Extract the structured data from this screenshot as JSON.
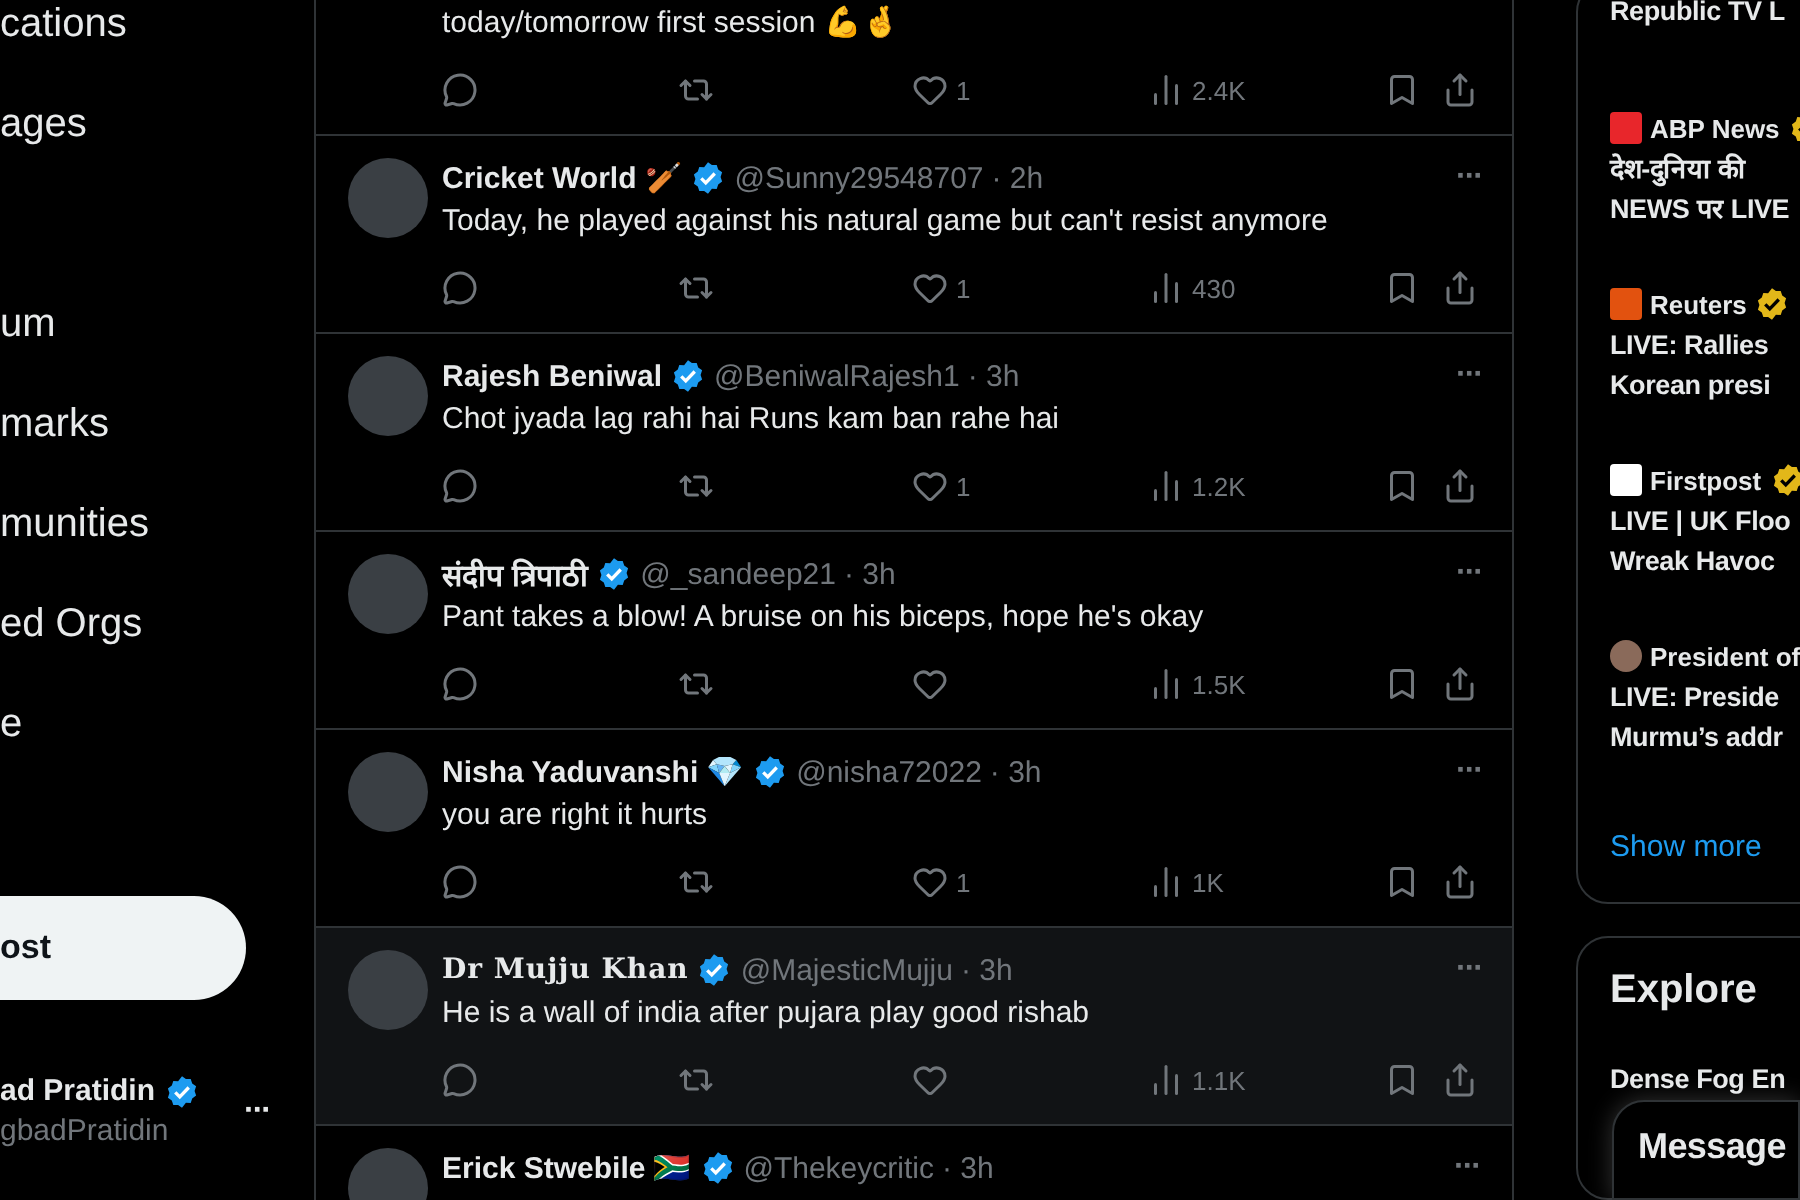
{
  "sidebar": {
    "nav_items": [
      {
        "label": "cations"
      },
      {
        "label": "ages"
      },
      {
        "kind": "hidden"
      },
      {
        "label": "um"
      },
      {
        "label": "marks"
      },
      {
        "label": "munities"
      },
      {
        "label": "ed Orgs"
      },
      {
        "label": "e"
      }
    ],
    "post_button": "ost",
    "account": {
      "name": "ad Pratidin",
      "handle": "gbadPratidin",
      "verified": true,
      "more": "···"
    }
  },
  "feed": {
    "posts": [
      {
        "kind": "partial",
        "text": "today/tomorrow first session 💪🤞",
        "likes": "1",
        "views": "2.4K",
        "highlighted": false
      },
      {
        "kind": "full",
        "name": "Cricket World",
        "serif_name": false,
        "emoji": "🏏",
        "verified": true,
        "handle": "@Sunny29548707",
        "time": "· 2h",
        "text": "Today, he played against his natural game but can't resist anymore",
        "likes": "1",
        "views": "430",
        "highlighted": false,
        "more": "···"
      },
      {
        "kind": "full",
        "name": "Rajesh Beniwal",
        "serif_name": false,
        "verified": true,
        "handle": "@BeniwalRajesh1",
        "time": "· 3h",
        "text": "Chot jyada lag rahi hai Runs kam ban rahe hai",
        "likes": "1",
        "views": "1.2K",
        "highlighted": false,
        "more": "···"
      },
      {
        "kind": "full",
        "name": "संदीप त्रिपाठी",
        "serif_name": false,
        "verified": true,
        "handle": "@_sandeep21",
        "time": "· 3h",
        "text": "Pant takes a blow! A bruise on his biceps, hope he's okay",
        "views": "1.5K",
        "highlighted": false,
        "more": "···"
      },
      {
        "kind": "full",
        "name": "Nisha Yaduvanshi",
        "serif_name": false,
        "emoji": "💎",
        "verified": true,
        "handle": "@nisha72022",
        "time": "· 3h",
        "text": "you are right it hurts",
        "likes": "1",
        "views": "1K",
        "highlighted": false,
        "more": "···"
      },
      {
        "kind": "full",
        "name": "Dr Mujju Khan",
        "serif_name": true,
        "verified": true,
        "handle": "@MajesticMujju",
        "time": "· 3h",
        "text": "He is a wall of india after pujara play good rishab",
        "views": "1.1K",
        "highlighted": true,
        "more": "···"
      },
      {
        "kind": "full",
        "name": "Erick Stwebile",
        "serif_name": false,
        "emoji": "🇿🇦",
        "verified": true,
        "handle": "@Thekeycritic",
        "time": "· 3h",
        "highlighted": false,
        "more": "···"
      }
    ]
  },
  "news": {
    "items": [
      {
        "kind": "partial",
        "headline": [
          "Republic TV L"
        ]
      },
      {
        "kind": "full",
        "source": "ABP News",
        "color": "#e8262b",
        "verified": true,
        "headline": [
          "देश-दुनिया की",
          "NEWS पर LIVE"
        ]
      },
      {
        "kind": "full",
        "source": "Reuters",
        "color": "#e2520f",
        "verified": true,
        "headline": [
          "LIVE: Rallies",
          "Korean presi"
        ]
      },
      {
        "kind": "full",
        "source": "Firstpost",
        "color": "#ffffff",
        "verified": true,
        "headline": [
          "LIVE | UK Floo",
          "Wreak Havoc"
        ]
      },
      {
        "kind": "full",
        "source": "President of",
        "color": "#8a6a5a",
        "headline": [
          "LIVE: Preside",
          "Murmu’s addr"
        ]
      }
    ],
    "show_more": "Show more"
  },
  "explore": {
    "title": "Explore",
    "trends": [
      "Dense Fog En"
    ]
  },
  "messages_drawer": {
    "title": "Message"
  }
}
